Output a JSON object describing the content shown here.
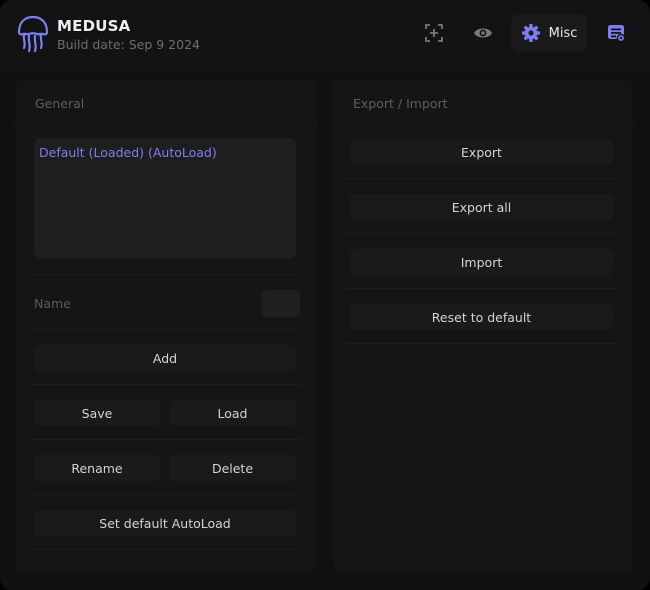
{
  "app": {
    "title": "MEDUSA",
    "build_date": "Build date: Sep 9 2024"
  },
  "header": {
    "buttons": [
      {
        "icon": "crosshair-plus-icon"
      },
      {
        "icon": "eye-icon"
      },
      {
        "icon": "gear-icon",
        "label": "Misc",
        "active": true
      },
      {
        "icon": "config-list-icon"
      }
    ]
  },
  "general": {
    "title": "General",
    "configs": [
      "Default (Loaded) (AutoLoad)"
    ],
    "name_label": "Name",
    "name_value": "",
    "add_label": "Add",
    "save_label": "Save",
    "load_label": "Load",
    "rename_label": "Rename",
    "delete_label": "Delete",
    "autoload_label": "Set default AutoLoad"
  },
  "export_import": {
    "title": "Export / Import",
    "export_label": "Export",
    "export_all_label": "Export all",
    "import_label": "Import",
    "reset_label": "Reset to default"
  },
  "colors": {
    "accent": "#7c7ff0",
    "background": "#111111",
    "panel": "#151515",
    "button": "#1a1a1a"
  }
}
